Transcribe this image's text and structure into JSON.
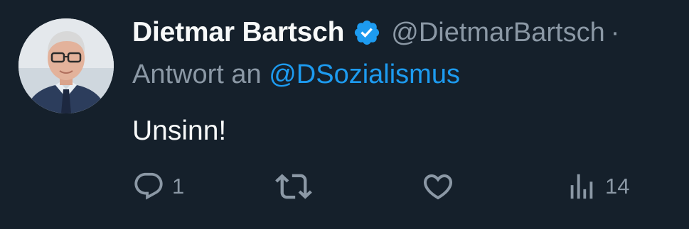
{
  "tweet": {
    "display_name": "Dietmar Bartsch",
    "handle": "@DietmarBartsch",
    "more": "·",
    "reply_prefix": "Antwort an",
    "reply_mention": "@DSozialismus",
    "text": "Unsinn!",
    "verified": true
  },
  "actions": {
    "reply": {
      "icon": "reply-icon",
      "count": "1"
    },
    "retweet": {
      "icon": "retweet-icon",
      "count": ""
    },
    "like": {
      "icon": "like-heart-icon",
      "count": ""
    },
    "views": {
      "icon": "views-bar-chart-icon",
      "count": "14"
    }
  },
  "colors": {
    "background": "#15202b",
    "text": "#f7f9f9",
    "secondary_text": "#8b98a5",
    "accent": "#1d9bf0"
  }
}
